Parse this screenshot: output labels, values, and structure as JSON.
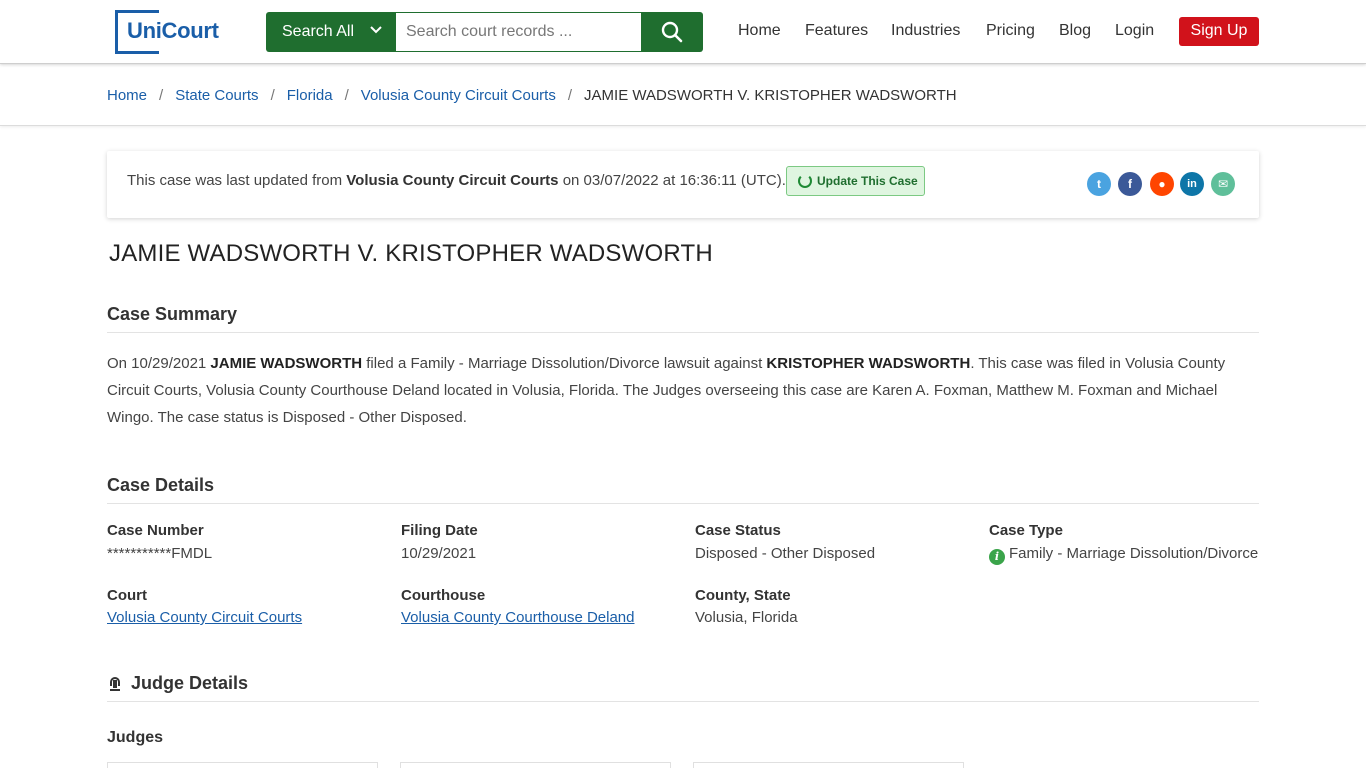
{
  "header": {
    "logo_text": "UniCourt",
    "search_scope": "Search All",
    "search_placeholder": "Search court records ...",
    "nav": [
      "Home",
      "Features",
      "Industries",
      "Pricing",
      "Blog",
      "Login"
    ],
    "signup": "Sign Up"
  },
  "breadcrumb": {
    "items": [
      "Home",
      "State Courts",
      "Florida",
      "Volusia County Circuit Courts"
    ],
    "current": "JAMIE WADSWORTH V. KRISTOPHER WADSWORTH",
    "separator": "/"
  },
  "update": {
    "prefix": "This case was last updated from",
    "court": "Volusia County Circuit Courts",
    "suffix": "on 03/07/2022 at 16:36:11 (UTC).",
    "button": "Update This Case"
  },
  "share_icons": [
    "twitter-icon",
    "facebook-icon",
    "reddit-icon",
    "linkedin-icon",
    "email-icon"
  ],
  "case_title": "JAMIE WADSWORTH V. KRISTOPHER WADSWORTH",
  "summary": {
    "heading": "Case Summary",
    "p1": "On 10/29/2021 ",
    "plaintiff": "JAMIE WADSWORTH",
    "p2": " filed a Family - Marriage Dissolution/Divorce lawsuit against ",
    "defendant": "KRISTOPHER WADSWORTH",
    "p3": ". This case was filed in Volusia County Circuit Courts, Volusia County Courthouse Deland located in Volusia, Florida. The Judges overseeing this case are Karen A. Foxman, Matthew M. Foxman and Michael Wingo. The case status is Disposed - Other Disposed."
  },
  "details": {
    "heading": "Case Details",
    "case_number_label": "Case Number",
    "case_number": "***********FMDL",
    "filing_date_label": "Filing Date",
    "filing_date": "10/29/2021",
    "case_status_label": "Case Status",
    "case_status": "Disposed - Other Disposed",
    "case_type_label": "Case Type",
    "case_type": "Family - Marriage Dissolution/Divorce",
    "court_label": "Court",
    "court": "Volusia County Circuit Courts",
    "courthouse_label": "Courthouse",
    "courthouse": "Volusia County Courthouse Deland",
    "county_label": "County, State",
    "county": "Volusia, Florida"
  },
  "judges": {
    "heading": "Judge Details",
    "subheading": "Judges"
  },
  "colors": {
    "primary_green": "#1f6e2f",
    "link_blue": "#1a5ea8",
    "signup_red": "#d1121b"
  }
}
